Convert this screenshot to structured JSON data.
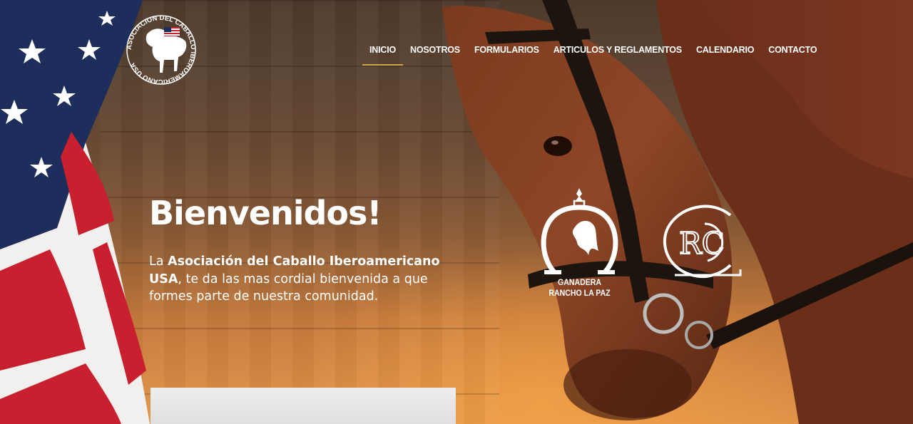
{
  "brand": {
    "logo_text": "ASOCIACION DEL CABALLO IBEROAMERICANO USA"
  },
  "nav": {
    "items": [
      {
        "label": "INICIO",
        "active": true
      },
      {
        "label": "NOSOTROS",
        "active": false
      },
      {
        "label": "FORMULARIOS",
        "active": false
      },
      {
        "label": "ARTICULOS Y REGLAMENTOS",
        "active": false
      },
      {
        "label": "CALENDARIO",
        "active": false
      },
      {
        "label": "CONTACTO",
        "active": false
      }
    ]
  },
  "hero": {
    "headline": "Bienvenidos!",
    "intro_prefix": "La ",
    "intro_bold_1": "Asociación del Caballo Iberoamericano",
    "intro_bold_2": "USA",
    "intro_suffix": ", te da las mas cordial bienvenida a que formes parte de nuestra comunidad."
  },
  "sponsors": {
    "ganadera_line1": "GANADERA",
    "ganadera_line2": "RANCHO LA PAZ",
    "rc_monogram": "RC"
  },
  "colors": {
    "accent": "#d0a24a",
    "text": "#ffffff"
  },
  "icons": {
    "logo": "horse-emblem-icon",
    "flag": "us-flag-image",
    "horse": "horse-photo"
  }
}
